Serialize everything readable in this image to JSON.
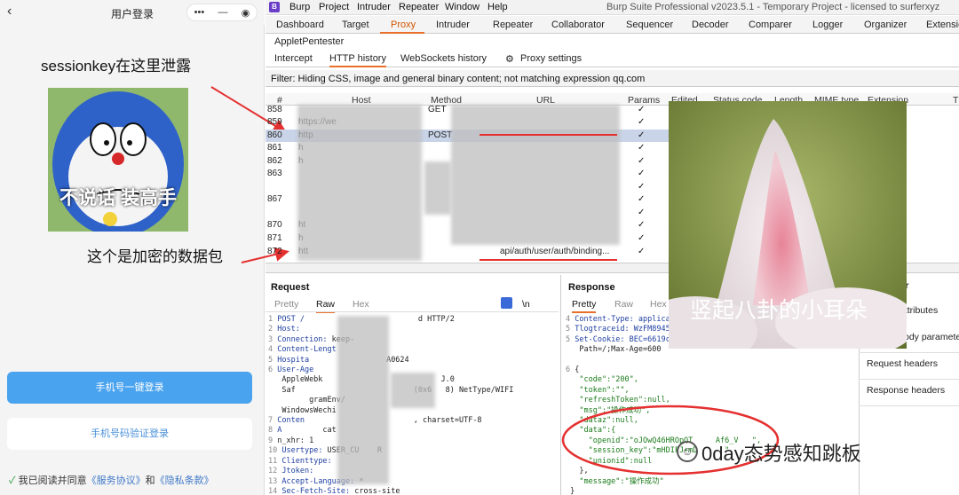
{
  "miniprogram": {
    "title": "用户登录",
    "back_glyph": "‹",
    "capsule": {
      "more": "•••",
      "minimize": "—",
      "close": "◉"
    },
    "annot_leak": "sessionkey在这里泄露",
    "meme_caption": "不说话 装高手",
    "annot_encrypted": "这个是加密的数据包",
    "btn_phone_login": "手机号一键登录",
    "btn_sms_login": "手机号码验证登录",
    "agreement": {
      "check": "✓",
      "prefix": "我已阅读并同意",
      "service": "《服务协议》",
      "and": "和",
      "privacy": "《隐私条款》"
    }
  },
  "burp": {
    "logo": "B",
    "menu": [
      "Burp",
      "Project",
      "Intruder",
      "Repeater",
      "Window",
      "Help"
    ],
    "window_title": "Burp Suite Professional v2023.5.1 - Temporary Project - licensed to surferxyz",
    "tabs": [
      "Dashboard",
      "Target",
      "Proxy",
      "Intruder",
      "Repeater",
      "Collaborator",
      "Sequencer",
      "Decoder",
      "Comparer",
      "Logger",
      "Organizer",
      "Extensio"
    ],
    "tab_applet": "AppletPentester",
    "subtabs": [
      "Intercept",
      "HTTP history",
      "WebSockets history"
    ],
    "proxy_settings": "Proxy settings",
    "gear_glyph": "⚙",
    "filter": "Filter: Hiding CSS, image and general binary content;  not matching expression qq.com",
    "columns": [
      "#",
      "Host",
      "Method",
      "URL",
      "Params",
      "Edited",
      "Status code",
      "Length",
      "MIME type",
      "Extension",
      "T"
    ],
    "rows": [
      {
        "n": "858",
        "host": "",
        "method": "GET",
        "url": "",
        "check": "✓"
      },
      {
        "n": "859",
        "host": "https://we",
        "method": "",
        "url": "",
        "check": "✓"
      },
      {
        "n": "860",
        "host": "http",
        "method": "POST",
        "url": "",
        "check": "✓"
      },
      {
        "n": "861",
        "host": "h",
        "method": "",
        "url": "",
        "check": "✓"
      },
      {
        "n": "862",
        "host": "h",
        "method": "",
        "url": "",
        "check": "✓"
      },
      {
        "n": "863",
        "host": "",
        "method": "",
        "url": "",
        "check": "✓"
      },
      {
        "n": "",
        "host": "",
        "method": "",
        "url": "",
        "check": "✓"
      },
      {
        "n": "867",
        "host": "",
        "method": "",
        "url": "",
        "check": "✓"
      },
      {
        "n": "",
        "host": "",
        "method": "",
        "url": "",
        "check": "✓"
      },
      {
        "n": "870",
        "host": "ht",
        "method": "",
        "url": "",
        "check": "✓"
      },
      {
        "n": "871",
        "host": "h",
        "method": "",
        "url": "",
        "check": "✓"
      },
      {
        "n": "872",
        "host": "htt",
        "method": "",
        "url": "api/auth/user/auth/binding...",
        "check": "✓"
      }
    ],
    "request": {
      "title": "Request",
      "tabs": [
        "Pretty",
        "Raw",
        "Hex"
      ],
      "lines": [
        {
          "n": "1",
          "k": "POST /",
          "v": "                         d HTTP/2"
        },
        {
          "n": "2",
          "k": "Host:",
          "v": ""
        },
        {
          "n": "3",
          "k": "Connection:",
          "v": " keep-"
        },
        {
          "n": "4",
          "k": "Content-Lengt",
          "v": ""
        },
        {
          "n": "5",
          "k": "Hospita",
          "v": "                 A0624"
        },
        {
          "n": "6",
          "k": "User-Age",
          "v": ""
        },
        {
          "n": "",
          "k": "",
          "v": "  AppleWebk                          J.0"
        },
        {
          "n": "",
          "k": "",
          "v": "  Saf                          (0x6   8) NetType/WIFI"
        },
        {
          "n": "",
          "k": "",
          "v": "        gramEnv/"
        },
        {
          "n": "",
          "k": "",
          "v": "  WindowsWechi"
        },
        {
          "n": "7",
          "k": "Conten",
          "v": "                        , charset=UTF-8"
        },
        {
          "n": "8",
          "k": "A",
          "v": "         cat"
        },
        {
          "n": "9",
          "k": "",
          "v": "n_xhr: 1"
        },
        {
          "n": "10",
          "k": "Usertype:",
          "v": " USER_CU    R"
        },
        {
          "n": "11",
          "k": "Clienttype:",
          "v": ""
        },
        {
          "n": "12",
          "k": "Jtoken:",
          "v": ""
        },
        {
          "n": "13",
          "k": "Accept-Language:",
          "v": " *"
        },
        {
          "n": "14",
          "k": "Sec-Fetch-Site:",
          "v": " cross-site"
        }
      ]
    },
    "response": {
      "title": "Response",
      "tabs": [
        "Pretty",
        "Raw",
        "Hex"
      ],
      "lines": [
        {
          "n": "4",
          "t": "Content-Type: applicat"
        },
        {
          "n": "5",
          "t": "Tlogtraceid: WzFM89456"
        },
        {
          "n": "5",
          "t": "Set-Cookie: BEC=6619cc"
        },
        {
          "n": "",
          "t": "  Path=/;Max-Age=600"
        },
        {
          "n": "",
          "t": ""
        },
        {
          "n": "6",
          "t": "{"
        },
        {
          "n": "",
          "t": "  \"code\":\"200\","
        },
        {
          "n": "",
          "t": "  \"token\":\"\","
        },
        {
          "n": "",
          "t": "  \"refreshToken\":null,"
        },
        {
          "n": "",
          "t": "  \"msg\":\"操作成功\","
        },
        {
          "n": "",
          "t": "  \"dataz\":null,"
        },
        {
          "n": "",
          "t": "  \"data\":{"
        },
        {
          "n": "",
          "t": "    \"openid\":\"oJOwQ46HROpQT     Af6_V   \","
        },
        {
          "n": "",
          "t": "    \"session_key\":\"mHDIFJ+mD      \","
        },
        {
          "n": "",
          "t": "    \"unionid\":null"
        },
        {
          "n": "",
          "t": "  },"
        },
        {
          "n": "",
          "t": "  \"message\":\"操作成功\""
        },
        {
          "n": "",
          "t": "}"
        }
      ]
    },
    "inspector": {
      "title_fragment": "or",
      "items": [
        "attributes",
        "ody paramete",
        "Request headers",
        "Response headers"
      ]
    },
    "pretty_ctrl": {
      "ln": "\\n"
    }
  },
  "overlay": {
    "cat_caption": "竖起八卦的小耳朵",
    "watermark": "0day态势感知跳板",
    "wechat_icon": "☺"
  },
  "colors": {
    "burp_orange": "#e8702a",
    "annotation_red": "#e53030",
    "login_blue": "#4aa3ef",
    "selected_row": "#c9d4e8"
  }
}
